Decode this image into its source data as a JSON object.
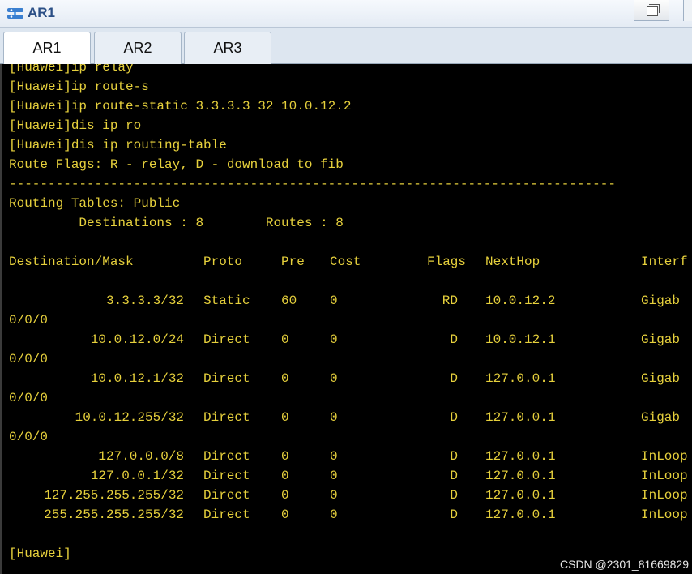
{
  "window": {
    "title": "AR1"
  },
  "tabs": [
    "AR1",
    "AR2",
    "AR3"
  ],
  "terminal": {
    "text_color": "#e6d03c",
    "background": "#000000",
    "lines": [
      "[Huawei]ip relay",
      "[Huawei]ip route-s",
      "[Huawei]ip route-static 3.3.3.3 32 10.0.12.2",
      "[Huawei]dis ip ro",
      "[Huawei]dis ip routing-table",
      "Route Flags: R - relay, D - download to fib",
      "------------------------------------------------------------------------------",
      "Routing Tables: Public",
      "         Destinations : 8        Routes : 8"
    ],
    "table_header": {
      "dest": "Destination/Mask",
      "proto": "Proto",
      "pre": "Pre",
      "cost": "Cost",
      "flags": "Flags",
      "nexthop": "NextHop",
      "iface": "Interf"
    },
    "rows": [
      {
        "dest": "3.3.3.3/32",
        "proto": "Static",
        "pre": "60",
        "cost": "0",
        "flags": "RD",
        "nexthop": "10.0.12.2",
        "iface": "Gigab",
        "cont": "0/0/0"
      },
      {
        "dest": "10.0.12.0/24",
        "proto": "Direct",
        "pre": "0",
        "cost": "0",
        "flags": "D",
        "nexthop": "10.0.12.1",
        "iface": "Gigab",
        "cont": "0/0/0"
      },
      {
        "dest": "10.0.12.1/32",
        "proto": "Direct",
        "pre": "0",
        "cost": "0",
        "flags": "D",
        "nexthop": "127.0.0.1",
        "iface": "Gigab",
        "cont": "0/0/0"
      },
      {
        "dest": "10.0.12.255/32",
        "proto": "Direct",
        "pre": "0",
        "cost": "0",
        "flags": "D",
        "nexthop": "127.0.0.1",
        "iface": "Gigab",
        "cont": "0/0/0"
      },
      {
        "dest": "127.0.0.0/8",
        "proto": "Direct",
        "pre": "0",
        "cost": "0",
        "flags": "D",
        "nexthop": "127.0.0.1",
        "iface": "InLoop",
        "cont": ""
      },
      {
        "dest": "127.0.0.1/32",
        "proto": "Direct",
        "pre": "0",
        "cost": "0",
        "flags": "D",
        "nexthop": "127.0.0.1",
        "iface": "InLoop",
        "cont": ""
      },
      {
        "dest": "127.255.255.255/32",
        "proto": "Direct",
        "pre": "0",
        "cost": "0",
        "flags": "D",
        "nexthop": "127.0.0.1",
        "iface": "InLoop",
        "cont": ""
      },
      {
        "dest": "255.255.255.255/32",
        "proto": "Direct",
        "pre": "0",
        "cost": "0",
        "flags": "D",
        "nexthop": "127.0.0.1",
        "iface": "InLoop",
        "cont": ""
      }
    ],
    "prompt": "[Huawei]"
  },
  "watermark": "CSDN @2301_81669829"
}
